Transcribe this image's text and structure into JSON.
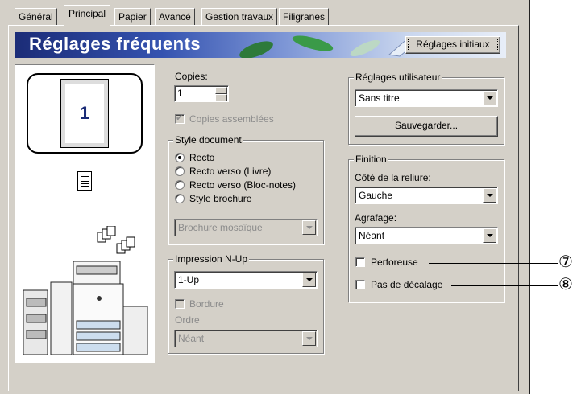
{
  "tabs": [
    "Général",
    "Principal",
    "Papier",
    "Avancé",
    "Gestion travaux",
    "Filigranes"
  ],
  "banner": {
    "title": "Réglages fréquents",
    "reset_button": "Réglages initiaux"
  },
  "preview": {
    "page_number": "1"
  },
  "copies": {
    "label": "Copies:",
    "value": "1",
    "collate_label": "Copies assemblées",
    "collate_checked": true
  },
  "document_style": {
    "title": "Style document",
    "options": [
      "Recto",
      "Recto verso (Livre)",
      "Recto verso (Bloc-notes)",
      "Style brochure"
    ],
    "selected": "Recto",
    "brochure_select": "Brochure mosaïque"
  },
  "nup": {
    "title": "Impression N-Up",
    "value": "1-Up",
    "border_label": "Bordure",
    "order_label": "Ordre",
    "order_value": "Néant"
  },
  "user_settings": {
    "title": "Réglages utilisateur",
    "value": "Sans titre",
    "save_button": "Sauvegarder..."
  },
  "finishing": {
    "title": "Finition",
    "binding_label": "Côté de la reliure:",
    "binding_value": "Gauche",
    "staple_label": "Agrafage:",
    "staple_value": "Néant",
    "punch_label": "Perforeuse",
    "offset_label": "Pas de décalage"
  },
  "callouts": [
    "⑦",
    "⑧"
  ]
}
